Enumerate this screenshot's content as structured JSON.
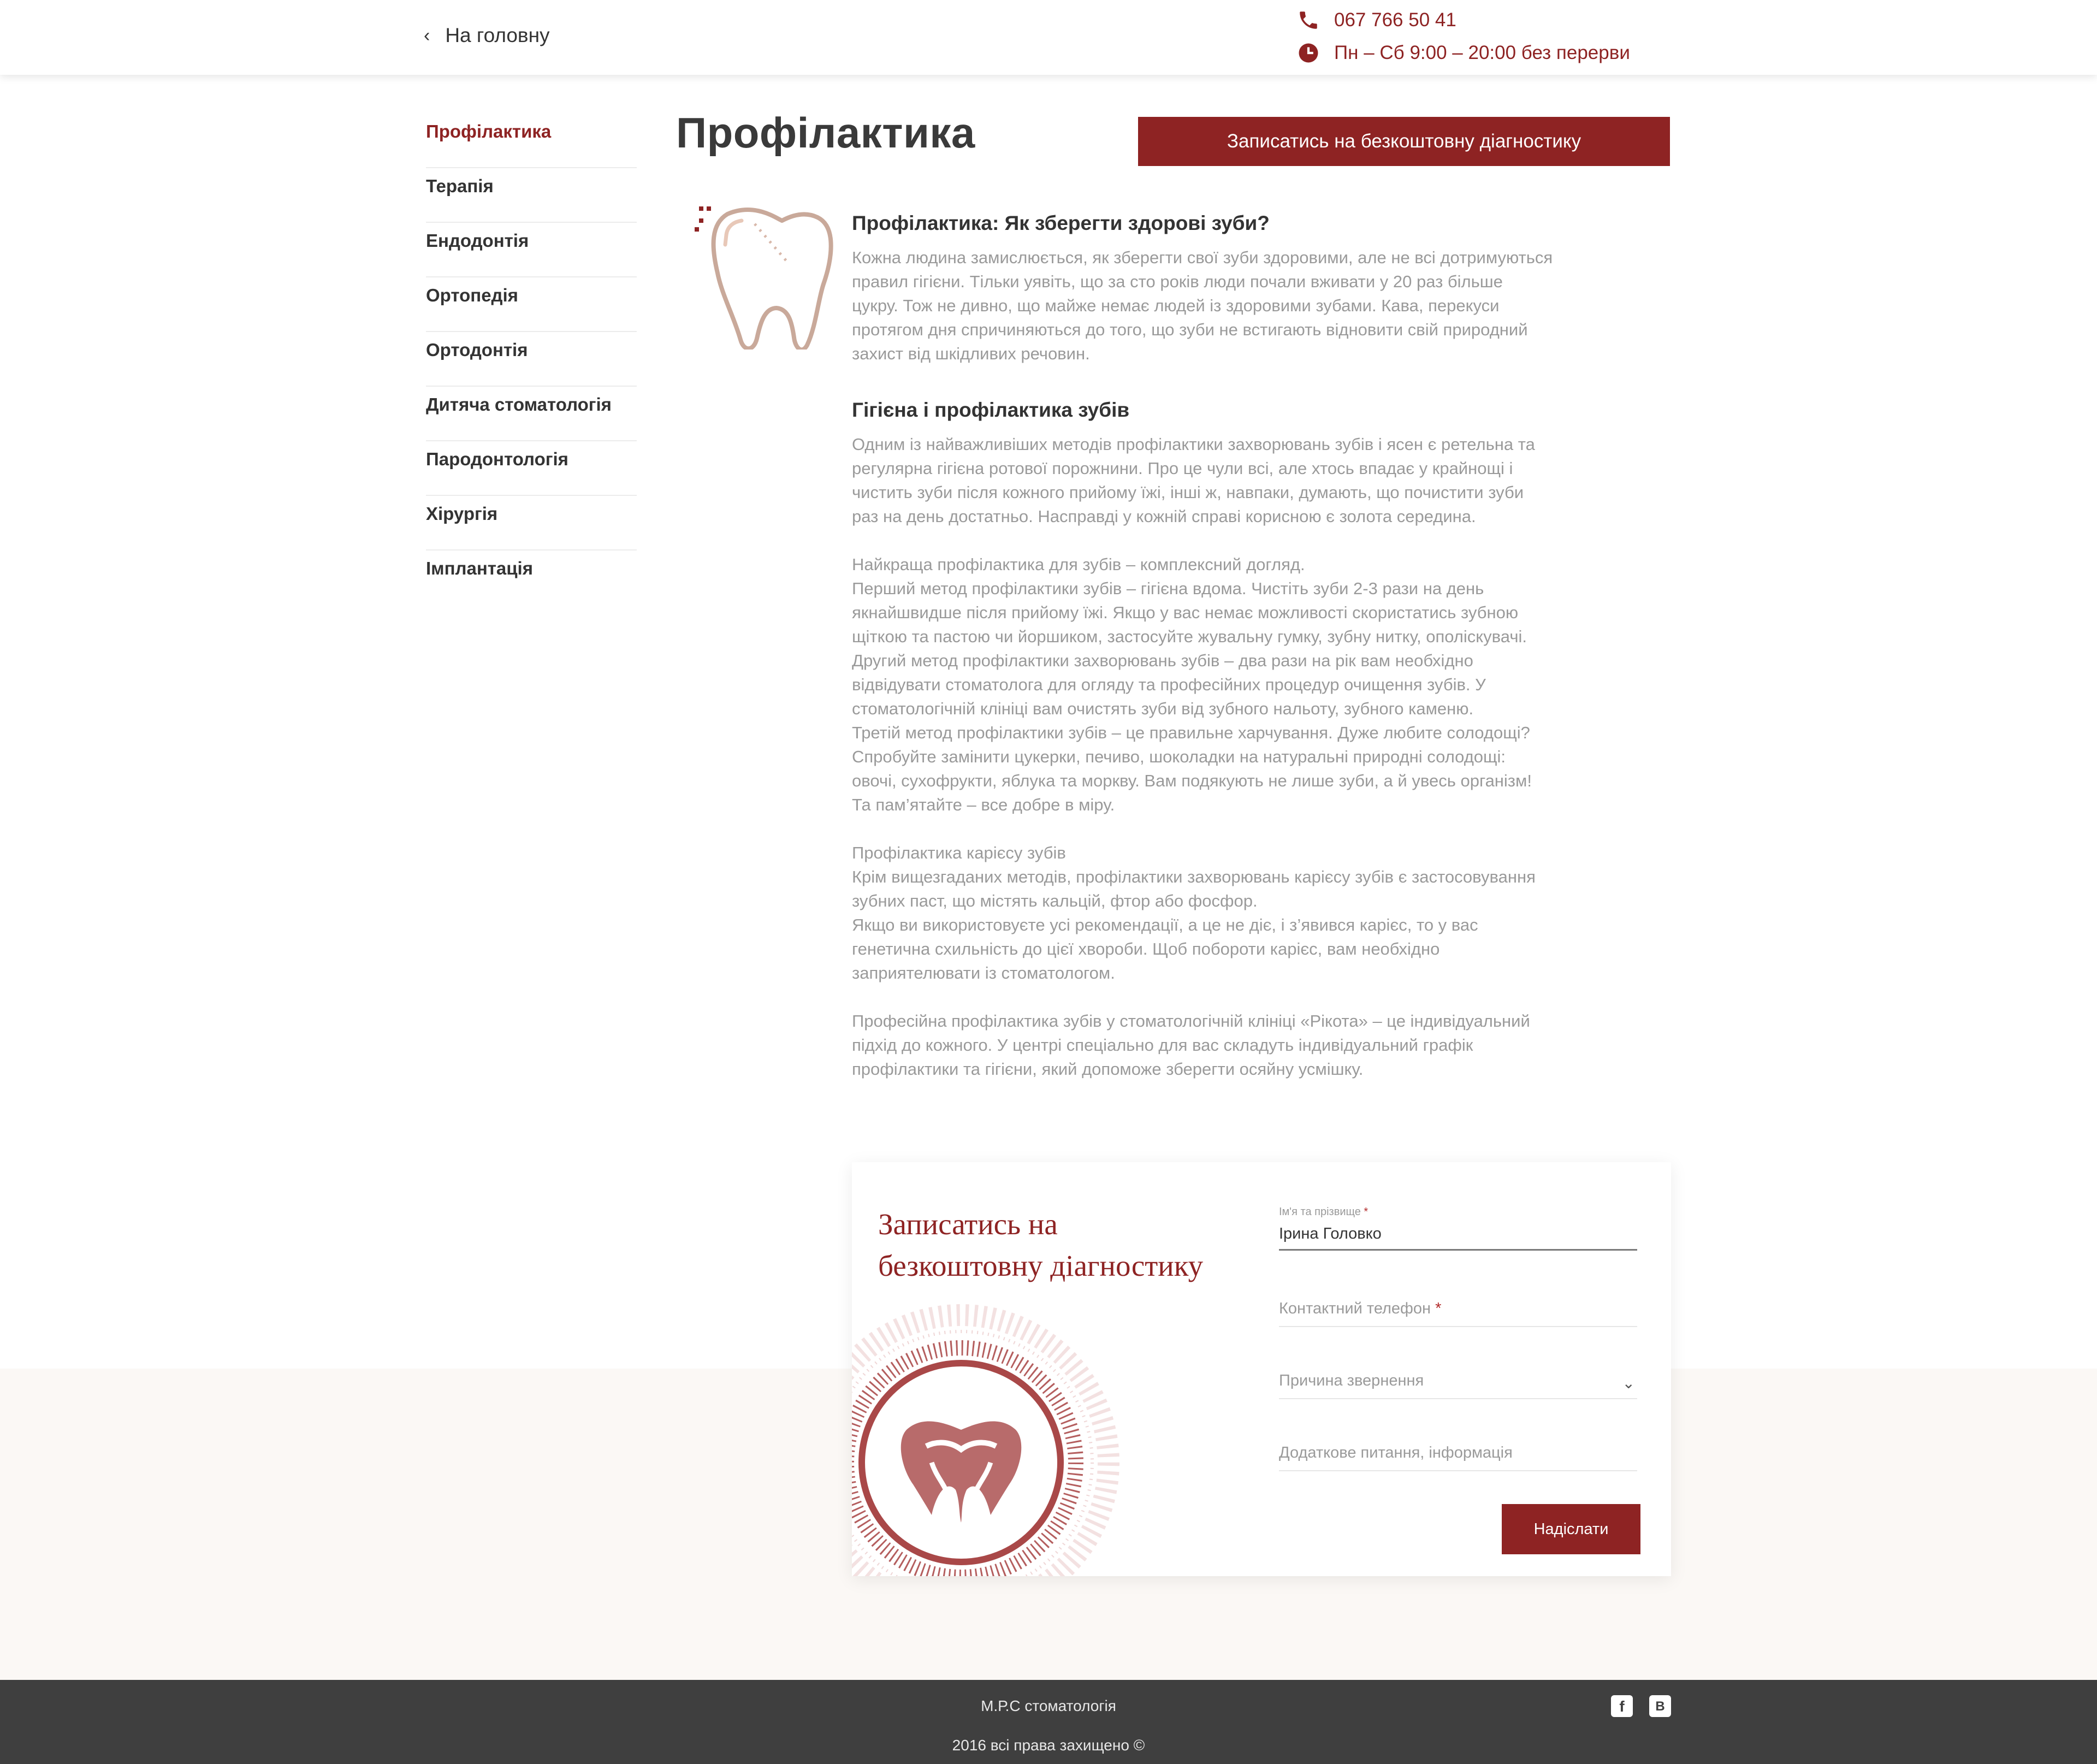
{
  "header": {
    "back_label": "На головну",
    "phone": "067 766 50 41",
    "hours": "Пн – Сб 9:00 – 20:00 без перерви",
    "accent_color": "#8e2323"
  },
  "sidebar": {
    "items": [
      {
        "label": "Профілактика",
        "active": true
      },
      {
        "label": "Терапія"
      },
      {
        "label": "Ендодонтія"
      },
      {
        "label": "Ортопедія"
      },
      {
        "label": "Ортодонтія"
      },
      {
        "label": "Дитяча стоматологія"
      },
      {
        "label": "Пародонтологія"
      },
      {
        "label": "Хірургія"
      },
      {
        "label": "Імплантація"
      }
    ]
  },
  "main": {
    "title": "Профілактика",
    "cta_label": "Записатись на безкоштовну діагностику",
    "icon": "tooth-icon",
    "section1_heading": "Профілактика: Як зберегти здорові зуби?",
    "section1_text": [
      "Кожна людина замислюється, як зберегти свої зуби здоровими, але не всі дотримуються",
      "правил гігієни. Тільки уявіть, що за сто років люди почали вживати у 20 раз більше",
      "цукру. Тож не дивно, що майже немає людей із здоровими зубами.  Кава, перекуси",
      "протягом дня спричиняються до того, що зуби не встигають відновити свій природний",
      "захист від шкідливих речовин."
    ],
    "section2_heading": "Гігієна і профілактика зубів",
    "section2_blocks": [
      [
        "Одним із найважливіших методів профілактики захворювань зубів і ясен є ретельна та",
        "регулярна гігієна ротової порожнини. Про це чули всі, але хтось впадає у крайнощі і",
        "чистить зуби після кожного прийому їжі, інші ж, навпаки, думають, що почистити зуби",
        "раз на день достатньо. Насправді у кожній справі корисною є золота середина."
      ],
      [
        "Найкраща профілактика для зубів – комплексний догляд.",
        "Перший метод профілактики зубів – гігієна вдома. Чистіть зуби 2-3 рази на день",
        "якнайшвидше після прийому їжі. Якщо у вас немає можливості скористатись зубною",
        "щіткою та пастою чи йоршиком, застосуйте жувальну гумку, зубну нитку, ополіскувачі.",
        "Другий метод профілактики захворювань зубів – два рази на рік вам необхідно",
        "відвідувати стоматолога для огляду та професійних процедур очищення зубів. У",
        "стоматологічній клініці вам очистять зуби від зубного нальоту, зубного каменю.",
        "Третій метод профілактики зубів – це правильне харчування. Дуже любите солодощі?",
        "Спробуйте замінити цукерки, печиво, шоколадки на натуральні природні солодощі:",
        "овочі, сухофрукти, яблука та моркву. Вам подякують не лише зуби, а й увесь організм!",
        "Та пам’ятайте – все добре в міру."
      ],
      [
        "Профілактика карієсу зубів",
        "Крім вищезгаданих методів, профілактики захворювань карієсу зубів є застосовування",
        "зубних паст, що містять кальцій, фтор або фосфор.",
        "Якщо ви використовуєте усі рекомендації, а це не діє, і з’явився карієс, то у вас",
        "генетична схильність до цієї хвороби. Щоб побороти карієс, вам необхідно",
        "заприятелювати із стоматологом."
      ],
      [
        "Професійна профілактика зубів у стоматологічній клініці «Рікота» – це індивідуальний",
        "підхід до кожного. У центрі спеціально для вас складуть індивідуальний графік",
        "профілактики та гігієни, який допоможе зберегти осяйну усмішку."
      ]
    ]
  },
  "form": {
    "title_line1": "Записатись на",
    "title_line2": "безкоштовну діагностику",
    "name_label": "Ім'я та прізвище",
    "name_value": "Ірина Головко",
    "phone_placeholder": "Контактний телефон",
    "reason_placeholder": "Причина звернення",
    "extra_placeholder": "Додаткове питання, інформація",
    "required_mark": "*",
    "submit_label": "Надіслати"
  },
  "footer": {
    "brand": "М.Р.С стоматологія",
    "copyright": "2016 всі права захищено ©",
    "social": [
      {
        "icon": "facebook-icon",
        "glyph": "f"
      },
      {
        "icon": "vk-icon",
        "glyph": "В"
      }
    ]
  }
}
